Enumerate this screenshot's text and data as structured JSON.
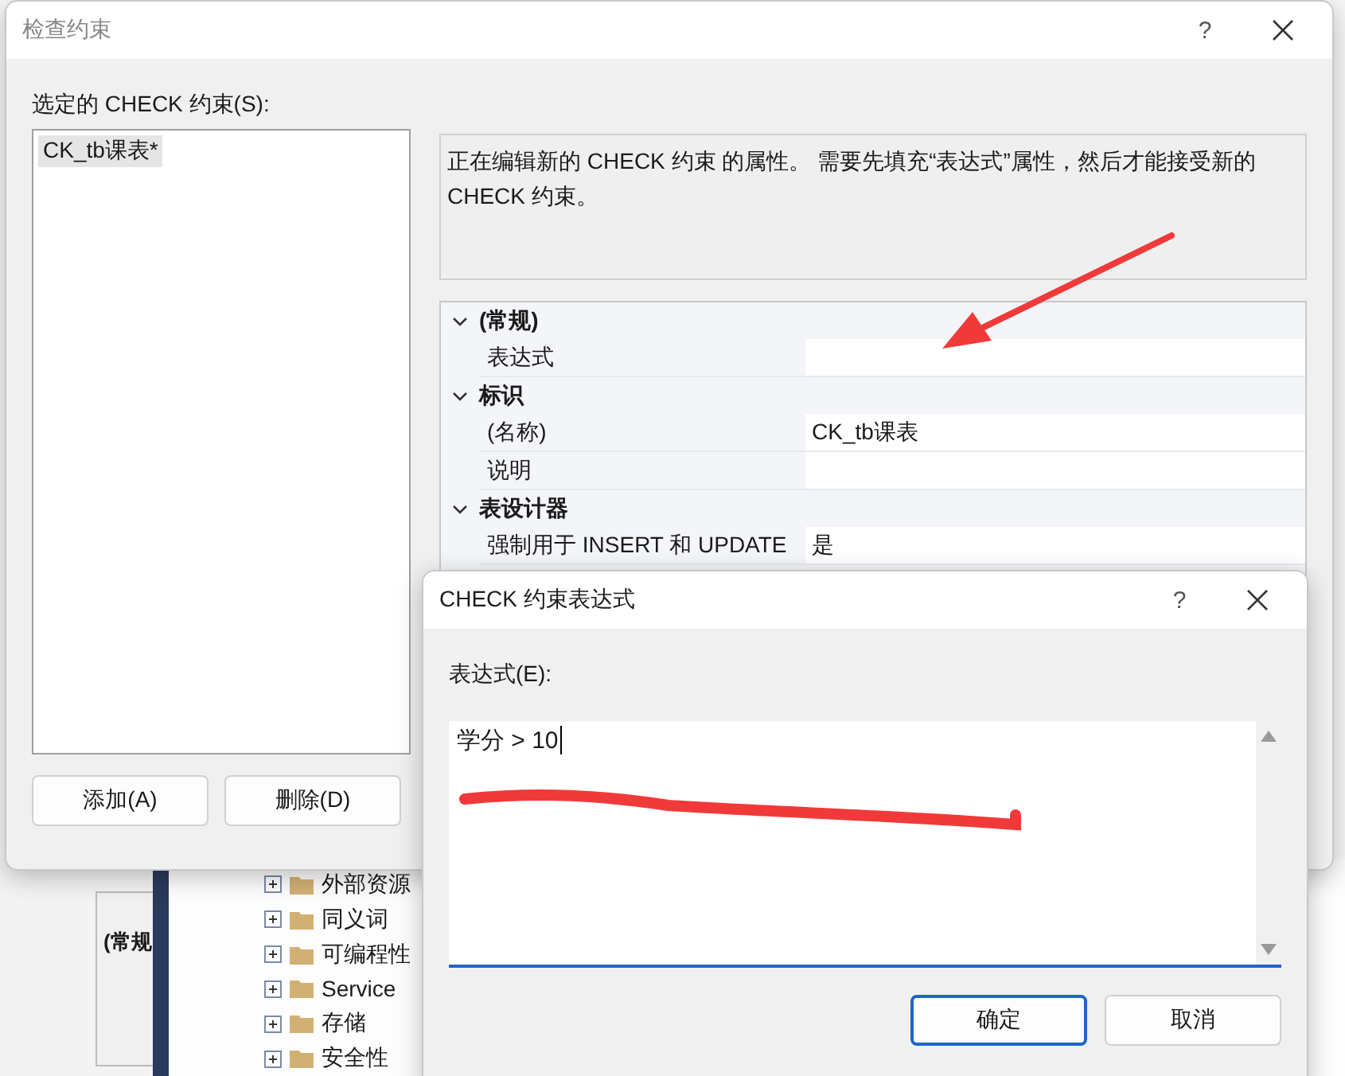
{
  "background": {
    "panel_heading": "(常规",
    "tree_items": [
      {
        "label": "外部资源",
        "expanded": false
      },
      {
        "label": "同义词",
        "expanded": false
      },
      {
        "label": "可编程性",
        "expanded": false
      },
      {
        "label": "Service",
        "expanded": false
      },
      {
        "label": "存储",
        "expanded": false
      },
      {
        "label": "安全性",
        "expanded": false
      }
    ]
  },
  "main_dialog": {
    "title": "检查约束",
    "help": "?",
    "list_label": "选定的 CHECK 约束(S):",
    "constraints": [
      {
        "name": "CK_tb课表*",
        "selected": true
      }
    ],
    "description": "正在编辑新的 CHECK 约束 的属性。 需要先填充“表达式”属性，然后才能接受新的 CHECK 约束。",
    "properties": [
      {
        "category": "(常规)",
        "expanded": true,
        "rows": [
          {
            "name": "表达式"
          }
        ]
      },
      {
        "category": "标识",
        "expanded": true,
        "rows": [
          {
            "name": "(名称)",
            "value": "CK_tb课表"
          },
          {
            "name": "说明"
          }
        ]
      },
      {
        "category": "表设计器",
        "expanded": true,
        "rows": [
          {
            "name": "强制用于 INSERT 和 UPDATE",
            "value": "是"
          }
        ]
      }
    ],
    "buttons": [
      {
        "label": "添加(A)"
      },
      {
        "label": "删除(D)"
      }
    ]
  },
  "expression_dialog": {
    "title": "CHECK 约束表达式",
    "help": "?",
    "field_label": "表达式(E):",
    "expression": "学分 > 10",
    "buttons": [
      {
        "label": "确定",
        "default": true
      },
      {
        "label": "取消",
        "default": false
      }
    ]
  }
}
